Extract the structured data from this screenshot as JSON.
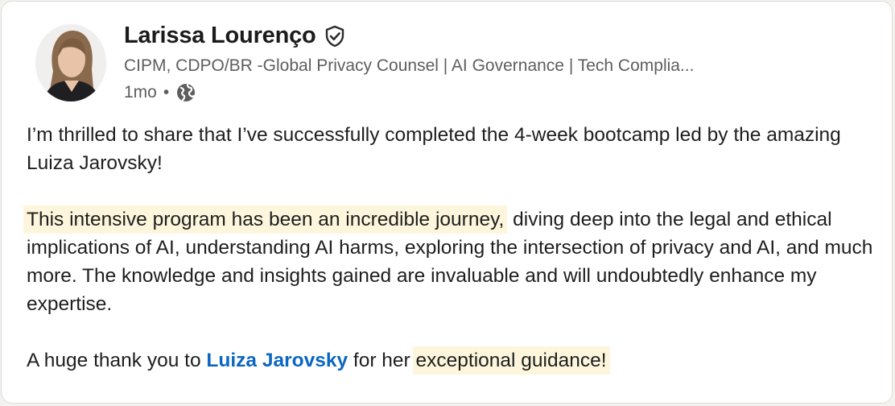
{
  "author": {
    "name": "Larissa Lourenço",
    "headline": "CIPM, CDPO/BR -Global Privacy Counsel | AI Governance | Tech Complia...",
    "time_ago": "1mo",
    "separator": "•"
  },
  "icons": {
    "verified": "verified-shield-icon",
    "visibility": "globe-icon"
  },
  "post": {
    "p1": "I’m thrilled to share that I’ve successfully completed the 4-week bootcamp led by the amazing Luiza Jarovsky!",
    "p2_highlight": "This intensive program has been an incredible journey,",
    "p2_rest": " diving deep into the legal and ethical implications of AI, understanding AI harms, exploring the intersection of privacy and AI, and much more. The knowledge and insights gained are invaluable and will undoubtedly enhance my expertise.",
    "p3_before": "A huge thank you to ",
    "p3_mention": "Luiza Jarovsky",
    "p3_between": " for her ",
    "p3_highlight": "exceptional guidance!"
  },
  "colors": {
    "highlight": "#fdf6dd",
    "mention": "#0a66c2",
    "text": "#1e1e1e",
    "muted": "#5e5e5e"
  }
}
